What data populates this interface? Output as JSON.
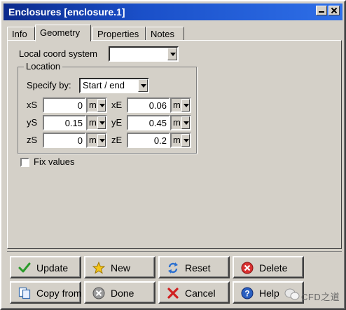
{
  "window": {
    "title": "Enclosures [enclosure.1]"
  },
  "tabs": [
    "Info",
    "Geometry",
    "Properties",
    "Notes"
  ],
  "active_tab": "Geometry",
  "local_coord": {
    "label": "Local coord system",
    "value": ""
  },
  "location": {
    "legend": "Location",
    "specify_label": "Specify by:",
    "specify_value": "Start / end",
    "fields": [
      {
        "label": "xS",
        "value": "0",
        "unit": "m"
      },
      {
        "label": "xE",
        "value": "0.06",
        "unit": "m"
      },
      {
        "label": "yS",
        "value": "0.15",
        "unit": "m"
      },
      {
        "label": "yE",
        "value": "0.45",
        "unit": "m"
      },
      {
        "label": "zS",
        "value": "0",
        "unit": "m"
      },
      {
        "label": "zE",
        "value": "0.2",
        "unit": "m"
      }
    ]
  },
  "fix_values": {
    "label": "Fix values",
    "checked": false
  },
  "buttons": {
    "update": "Update",
    "new": "New",
    "reset": "Reset",
    "delete": "Delete",
    "copy_from": "Copy from",
    "done": "Done",
    "cancel": "Cancel",
    "help": "Help"
  },
  "icons": {
    "update": "checkmark-icon",
    "new": "star-icon",
    "reset": "refresh-icon",
    "delete": "delete-icon",
    "copy_from": "copy-icon",
    "done": "done-icon",
    "cancel": "cross-icon",
    "help": "help-icon"
  },
  "watermark": "CFD之道",
  "colors": {
    "titlebar": "#0c2a8c",
    "background": "#d4d0c8"
  }
}
